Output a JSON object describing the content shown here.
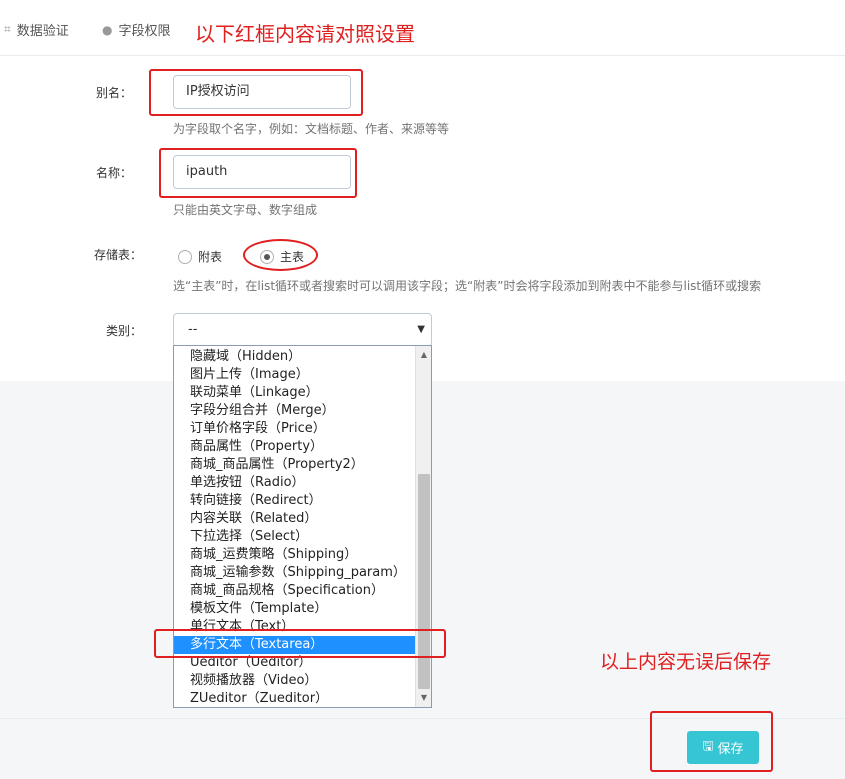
{
  "tabs": [
    {
      "label": "数据验证",
      "icon": "crop-icon"
    },
    {
      "label": "字段权限",
      "icon": "user-icon"
    }
  ],
  "annotations": {
    "top": "以下红框内容请对照设置",
    "bottom": "以上内容无误后保存"
  },
  "form": {
    "alias": {
      "label": "别名：",
      "value": "IP授权访问",
      "help": "为字段取个名字，例如：文档标题、作者、来源等等"
    },
    "name": {
      "label": "名称：",
      "value": "ipauth",
      "help": "只能由英文字母、数字组成"
    },
    "storage": {
      "label": "存储表：",
      "options": [
        {
          "label": "附表",
          "checked": false
        },
        {
          "label": "主表",
          "checked": true
        }
      ],
      "help": "选“主表”时，在list循环或者搜索时可以调用该字段；选“附表”时会将字段添加到附表中不能参与list循环或搜索"
    },
    "category": {
      "label": "类别：",
      "selected": "--",
      "options": [
        "隐藏域（Hidden）",
        "图片上传（Image）",
        "联动菜单（Linkage）",
        "字段分组合并（Merge）",
        "订单价格字段（Price）",
        "商品属性（Property）",
        "商城_商品属性（Property2）",
        "单选按钮（Radio）",
        "转向链接（Redirect）",
        "内容关联（Related）",
        "下拉选择（Select）",
        "商城_运费策略（Shipping）",
        "商城_运输参数（Shipping_param）",
        "商城_商品规格（Specification）",
        "模板文件（Template）",
        "单行文本（Text）",
        "多行文本（Textarea）",
        "Ueditor（Ueditor）",
        "视频播放器（Video）",
        "ZUeditor（Zueditor）"
      ],
      "highlighted": "多行文本（Textarea）"
    }
  },
  "buttons": {
    "save": "保存"
  },
  "colors": {
    "annotation": "#e02020",
    "save_button": "#36c6d3",
    "selected_option": "#1e90ff"
  }
}
